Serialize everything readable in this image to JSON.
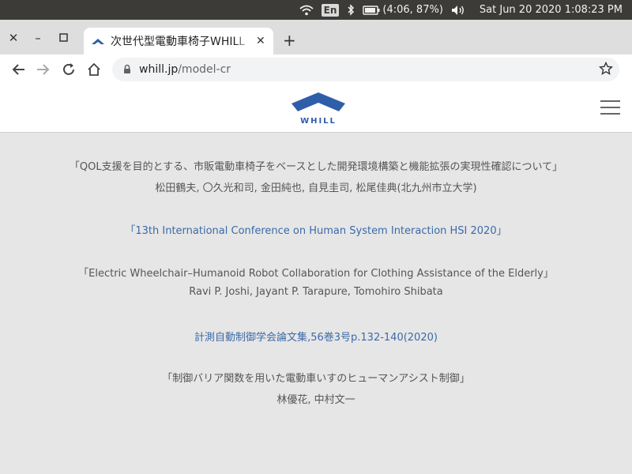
{
  "system": {
    "lang": "En",
    "battery": "(4:06, 87%)",
    "datetime": "Sat Jun 20 2020  1:08:23 PM"
  },
  "browser": {
    "tab_title": "次世代型電動車椅子WHILL",
    "url_domain": "whill.jp",
    "url_path": "/model-cr"
  },
  "site": {
    "logo_text": "WHILL"
  },
  "content": {
    "p1_title": "「QOL支援を目的とする、市販電動車椅子をベースとした開発環境構築と機能拡張の実現性確認について」",
    "p1_authors": "松田鶴夫, 〇久光和司, 金田純也, 自見圭司, 松尾佳典(北九州市立大学)",
    "p2_link": "「13th International Conference on Human System Interaction HSI 2020」",
    "p3_title": "「Electric Wheelchair–Humanoid Robot Collaboration for Clothing Assistance of the Elderly」",
    "p3_authors": "Ravi P. Joshi, Jayant P. Tarapure, Tomohiro Shibata",
    "p4_link_a": "計測自動制御学会論文集",
    "p4_link_b": ",56巻3号",
    "p4_link_c": "p.132-140(2020)",
    "p5_title": "「制御バリア関数を用いた電動車いすのヒューマンアシスト制御」",
    "p5_authors": "林優花, 中村文一"
  },
  "colors": {
    "link": "#3b6aa8",
    "logo": "#2f5ea8"
  }
}
